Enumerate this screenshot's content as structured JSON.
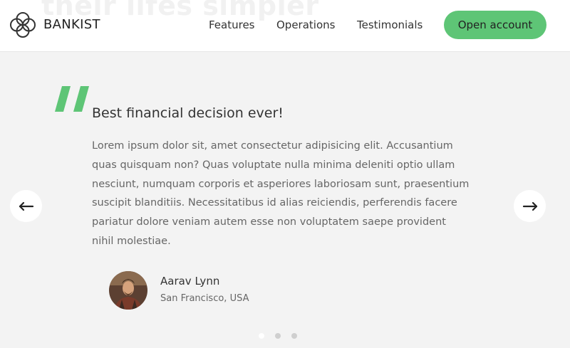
{
  "hero": {
    "ghost_heading": "their lifes simpler"
  },
  "nav": {
    "brand": "BANKIST",
    "logo_icon": "bankist-logo-icon",
    "links": [
      {
        "label": "Features"
      },
      {
        "label": "Operations"
      },
      {
        "label": "Testimonials"
      }
    ],
    "cta_label": "Open account"
  },
  "testimonial": {
    "quote_icon": "quote-mark-icon",
    "title": "Best financial decision ever!",
    "text": "Lorem ipsum dolor sit, amet consectetur adipisicing elit. Accusantium quas quisquam non? Quas voluptate nulla minima deleniti optio ullam nesciunt, numquam corporis et asperiores laboriosam sunt, praesentium suscipit blanditiis. Necessitatibus id alias reiciendis, perferendis facere pariatur dolore veniam autem esse non voluptatem saepe provident nihil molestiae.",
    "author": {
      "name": "Aarav Lynn",
      "location": "San Francisco, USA"
    }
  },
  "slider": {
    "prev_icon": "arrow-left-icon",
    "next_icon": "arrow-right-icon",
    "dot_count": 3,
    "active_dot": 0
  },
  "colors": {
    "accent": "#5ec576",
    "background": "#f3f3f3",
    "nav_background": "#ffffff"
  }
}
